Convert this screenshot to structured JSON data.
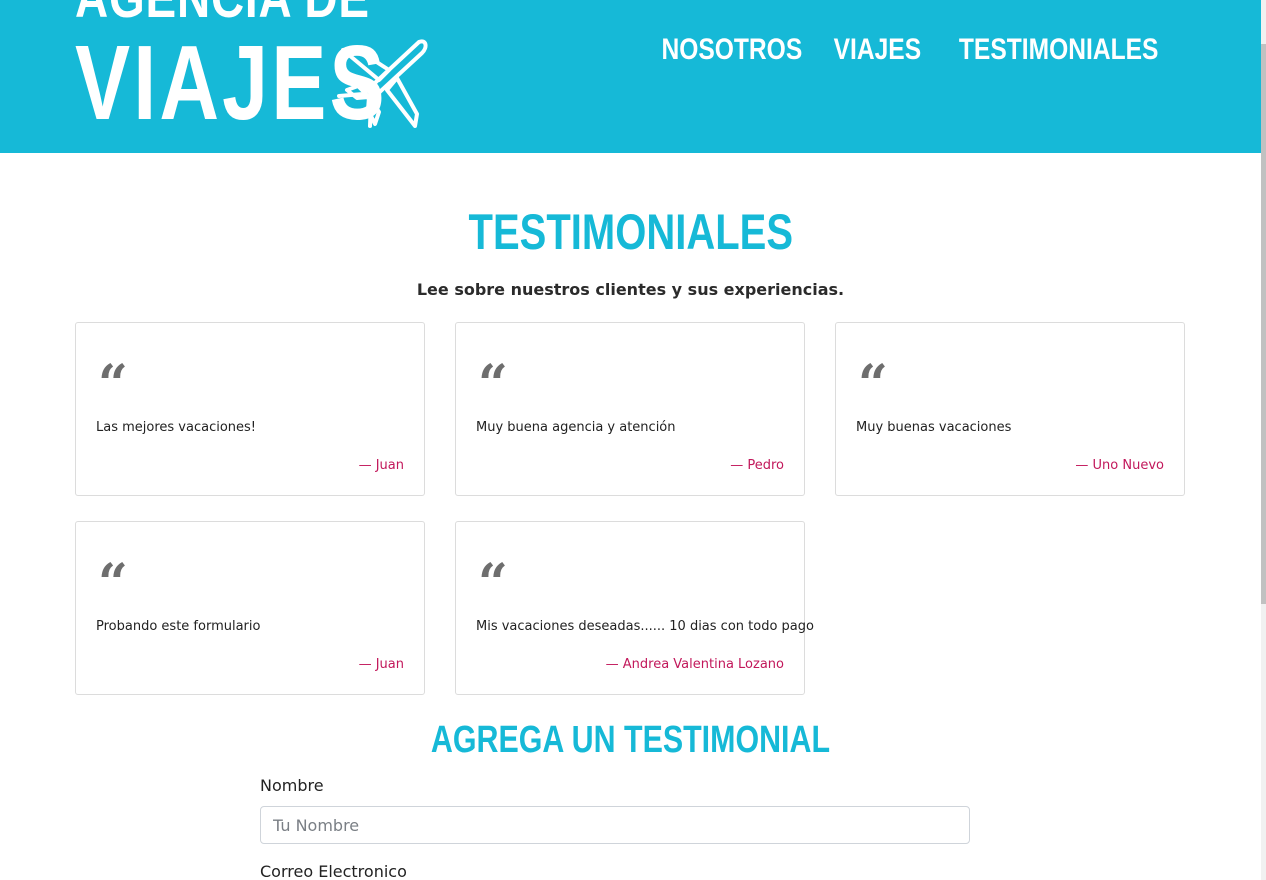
{
  "header": {
    "logo_line1": "AGENCIA DE",
    "logo_line2": "VIAJES",
    "logo_icon": "airplane-icon",
    "nav": [
      {
        "label": "Nosotros"
      },
      {
        "label": "Viajes"
      },
      {
        "label": "Testimoniales"
      }
    ],
    "brand_color": "#16b9d7"
  },
  "testimonials": {
    "title": "Testimoniales",
    "subtitle": "Lee sobre nuestros clientes y sus experiencias.",
    "quote_icon": "quote-icon",
    "author_color": "#c2185b",
    "items": [
      {
        "message": "Las mejores vacaciones!",
        "author": "— Juan"
      },
      {
        "message": "Muy buena agencia y atención",
        "author": "— Pedro"
      },
      {
        "message": "Muy buenas vacaciones",
        "author": "— Uno Nuevo"
      },
      {
        "message": "Probando este formulario",
        "author": "— Juan"
      },
      {
        "message": "Mis vacaciones deseadas...... 10 dias con todo pago",
        "author": "— Andrea Valentina Lozano"
      }
    ]
  },
  "form": {
    "title": "Agrega un Testimonial",
    "nombre_label": "Nombre",
    "nombre_placeholder": "Tu Nombre",
    "nombre_value": "",
    "correo_label": "Correo Electronico"
  }
}
